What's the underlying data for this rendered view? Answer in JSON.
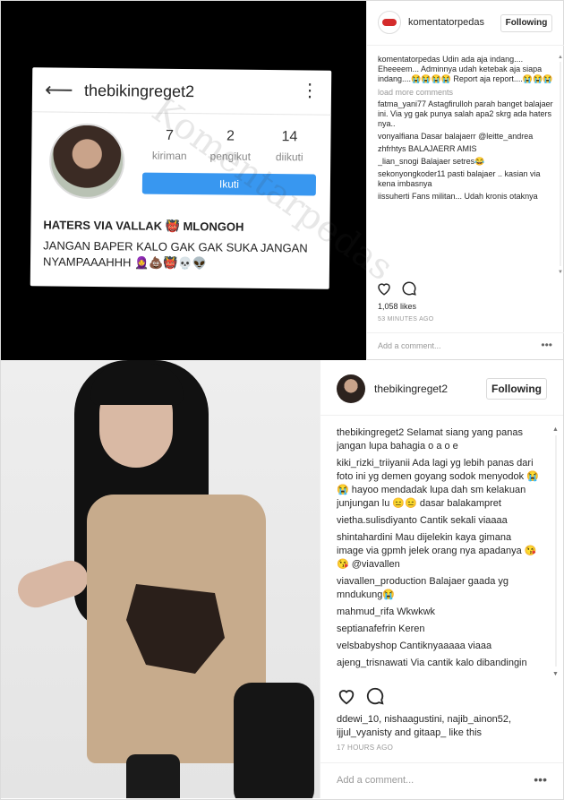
{
  "post1": {
    "image": {
      "profile_username": "thebikingreget2",
      "stats": [
        {
          "num": "7",
          "label": "kiriman"
        },
        {
          "num": "2",
          "label": "pengikut"
        },
        {
          "num": "14",
          "label": "diikuti"
        }
      ],
      "follow_label": "Ikuti",
      "bio_line1": "HATERS VIA VALLAK 👹 MLONGOH",
      "bio_line2": "JANGAN BAPER KALO GAK GAK SUKA JANGAN NYAMPAAAHHH 🧕💩👹💀👽",
      "watermark": "Komentarpedas"
    },
    "header": {
      "username": "komentatorpedas",
      "follow_label": "Following"
    },
    "caption": {
      "user": "komentatorpedas",
      "text": "Udin ada aja indang.... Eheeeem... Adminnya udah ketebak aja siapa indang....😭😭😭😭 Report aja report....😭😭😭"
    },
    "load_more": "load more comments",
    "comments": [
      {
        "user": "fatma_yani77",
        "text": "Astagfirulloh parah banget balajaer ini. Via yg gak punya salah apa2 skrg ada haters nya.."
      },
      {
        "user": "vonyalfiana",
        "text": "Dasar balajaerr @leitte_andrea"
      },
      {
        "user": "zhfrhtys",
        "text": "BALAJAERR AMIS"
      },
      {
        "user": "_lian_snogi",
        "text": "Balajaer setres😂"
      },
      {
        "user": "sekonyongkoder11",
        "text": "pasti balajaer .. kasian via kena imbasnya"
      },
      {
        "user": "iissuherti",
        "text": "Fans militan... Udah kronis otaknya"
      }
    ],
    "likes": "1,058 likes",
    "time": "53 MINUTES AGO",
    "add_comment_placeholder": "Add a comment...",
    "more_label": "•••"
  },
  "post2": {
    "header": {
      "username": "thebikingreget2",
      "follow_label": "Following"
    },
    "caption": {
      "user": "thebikingreget2",
      "text": "Selamat siang yang panas jangan lupa bahagia o a o e"
    },
    "comments": [
      {
        "user": "kiki_rizki_triiyanii",
        "text": "Ada lagi yg lebih panas dari foto ini yg demen goyang sodok menyodok 😭😭 hayoo mendadak lupa dah sm kelakuan junjungan lu 😑😑 dasar balakampret"
      },
      {
        "user": "vietha.sulisdiyanto",
        "text": "Cantik sekali viaaaa"
      },
      {
        "user": "shintahardini",
        "text": "Mau dijelekin kaya gimana image via gpmh jelek orang nya apadanya 😘😘 @viavallen"
      },
      {
        "user": "viavallen_production",
        "text": "Balajaer gaada yg mndukung😭"
      },
      {
        "user": "mahmud_rifa",
        "text": "Wkwkwk"
      },
      {
        "user": "septianafefrin",
        "text": "Keren"
      },
      {
        "user": "velsbabyshop",
        "text": "Cantiknyaaaaa viaaa"
      },
      {
        "user": "ajeng_trisnawati",
        "text": "Via cantik kalo dibandingin"
      }
    ],
    "likes": "ddewi_10, nishaagustini, najib_ainon52, ijjul_vyanisty and gitaap_ like this",
    "time": "17 HOURS AGO",
    "add_comment_placeholder": "Add a comment...",
    "more_label": "•••"
  },
  "colors": {
    "follow_blue": "#3897f0",
    "text": "#262626",
    "muted": "#999999"
  }
}
